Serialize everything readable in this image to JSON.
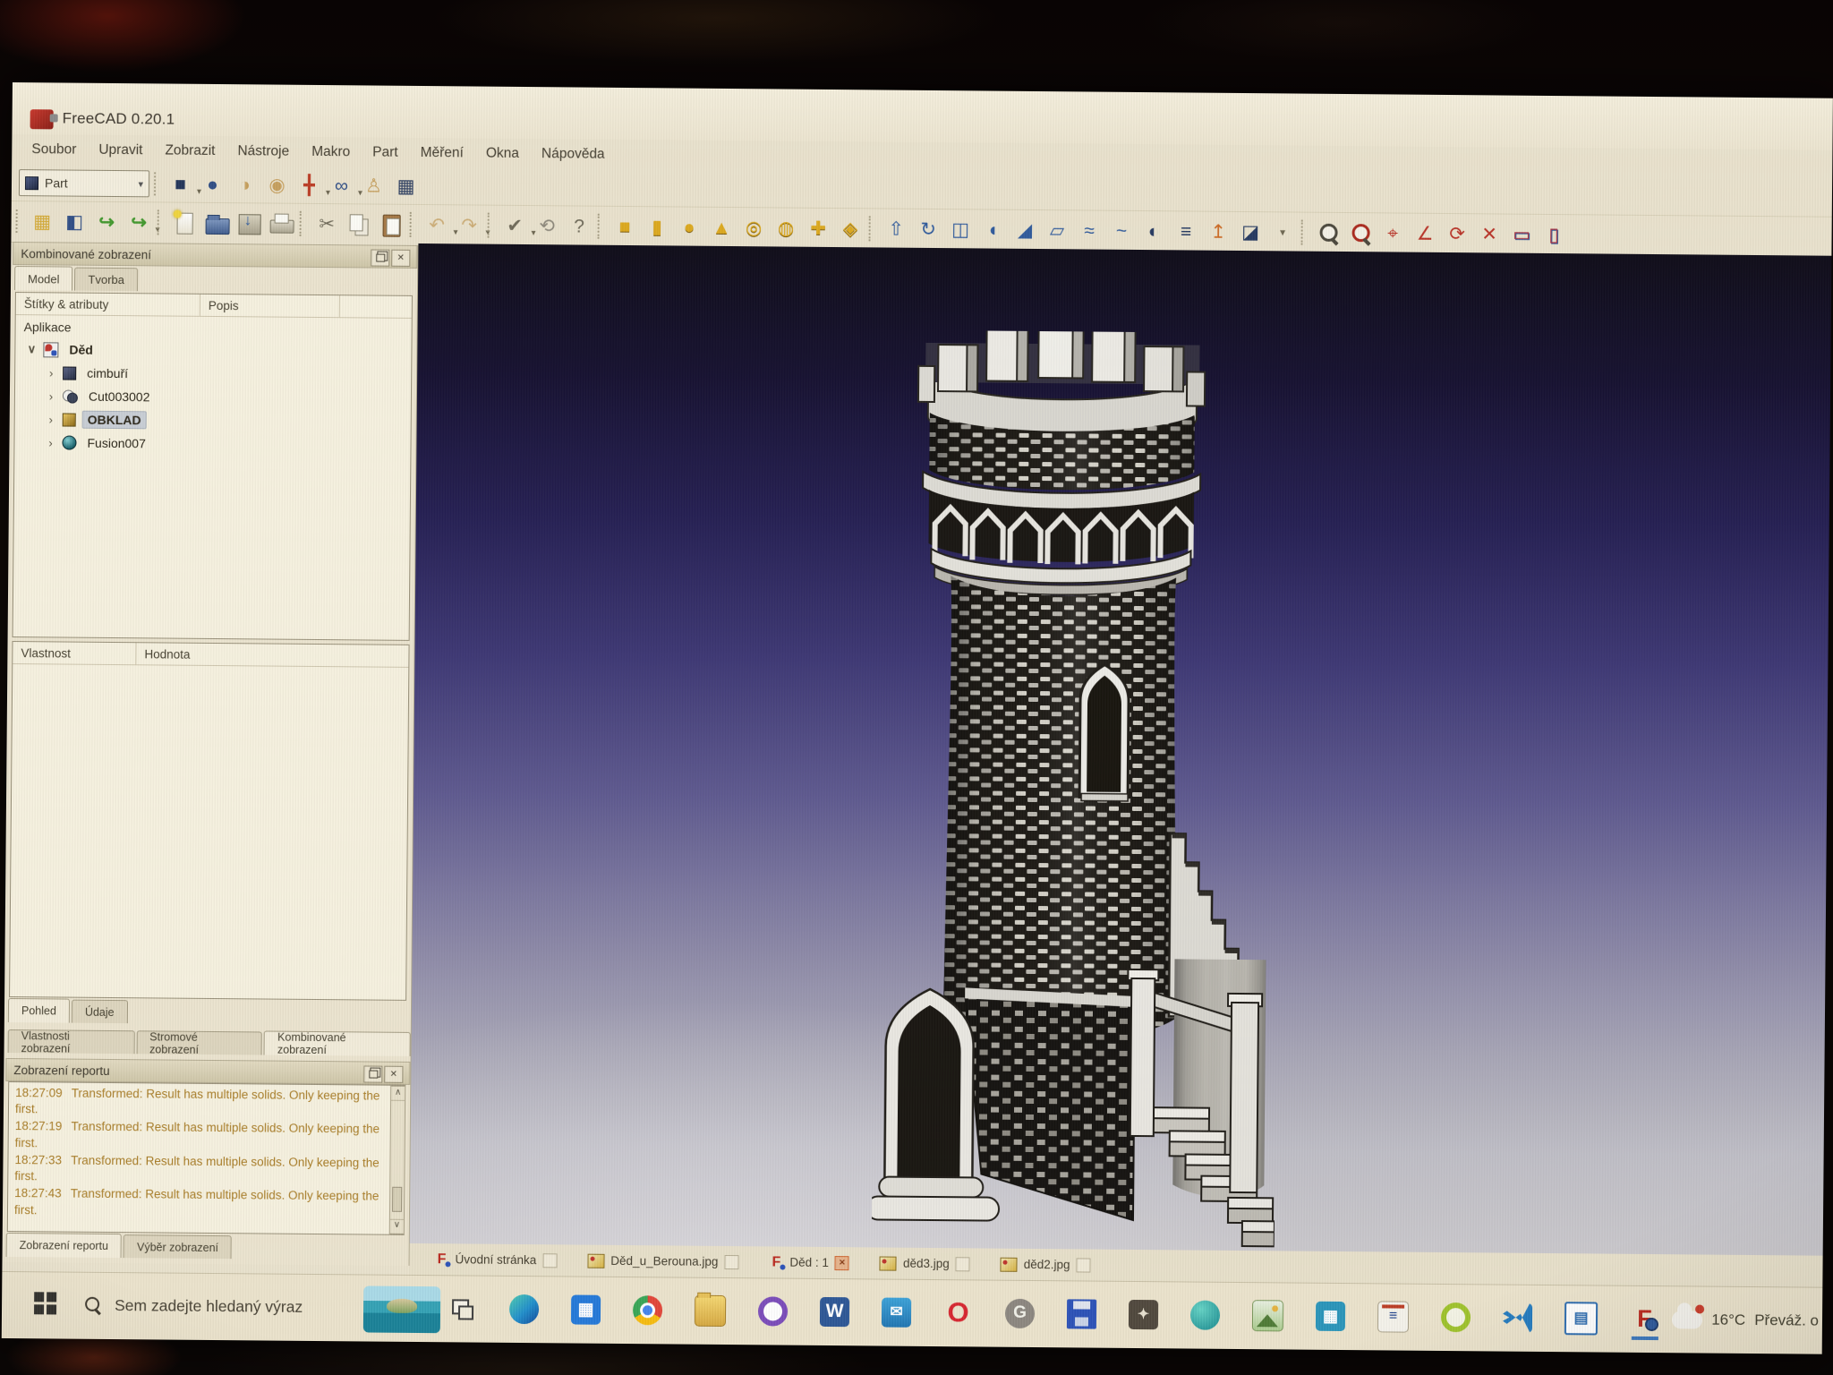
{
  "window": {
    "title": "FreeCAD 0.20.1"
  },
  "glyphs": {
    "close": "✕",
    "dropdown": "▾",
    "scroll_up": "∧",
    "scroll_down": "∨",
    "expanded": "∨",
    "collapsed": "›"
  },
  "menu": {
    "items": [
      "Soubor",
      "Upravit",
      "Zobrazit",
      "Nástroje",
      "Makro",
      "Part",
      "Měření",
      "Okna",
      "Nápověda"
    ]
  },
  "toolbar_row1": {
    "workbench_label": "Part",
    "icons": [
      {
        "name": "compound-tools-icon",
        "cls": "navy",
        "glyph": "■",
        "dd": "▾"
      },
      {
        "name": "boolean-union-icon",
        "cls": "blue",
        "glyph": "●"
      },
      {
        "name": "boolean-cut-icon",
        "cls": "tan",
        "glyph": "◑"
      },
      {
        "name": "boolean-common-icon",
        "cls": "tan",
        "glyph": "◉"
      },
      {
        "name": "pipe-tool-icon",
        "cls": "red",
        "glyph": "╋",
        "dd": "▾"
      },
      {
        "name": "join-features-icon",
        "cls": "blue",
        "glyph": "∞",
        "dd": "▾"
      },
      {
        "name": "mannequin-icon",
        "cls": "tan",
        "glyph": "♙"
      },
      {
        "name": "measure-box-icon",
        "cls": "navy",
        "glyph": "▦"
      }
    ]
  },
  "toolbar_row2": {
    "icons": [
      {
        "name": "parts-workbench-icon",
        "cls": "gold",
        "glyph": "▦"
      },
      {
        "name": "folder-blue-icon",
        "cls": "blue",
        "glyph": "◧"
      },
      {
        "name": "import-icon",
        "cls": "green",
        "glyph": "↪"
      },
      {
        "name": "export-icon",
        "cls": "green",
        "glyph": "↪",
        "dd": "▾"
      },
      {
        "cls": "sep"
      },
      {
        "name": "new-document-icon",
        "cls": "ic-new"
      },
      {
        "name": "open-document-icon",
        "cls": "ic-open"
      },
      {
        "name": "save-icon",
        "cls": "ic-save"
      },
      {
        "name": "print-icon",
        "cls": "ic-print"
      },
      {
        "cls": "sep"
      },
      {
        "name": "cut-icon",
        "cls": "dim",
        "glyph": "✂"
      },
      {
        "name": "copy-icon",
        "cls": "ic-copy"
      },
      {
        "name": "paste-icon",
        "cls": "ic-paste"
      },
      {
        "cls": "sep"
      },
      {
        "name": "undo-icon",
        "cls": "tanfade",
        "glyph": "↶",
        "dd": "▾"
      },
      {
        "name": "redo-icon",
        "cls": "tanfade",
        "glyph": "↷",
        "dd": "▾"
      },
      {
        "cls": "sep"
      },
      {
        "name": "validate-icon",
        "cls": "dim",
        "glyph": "✔",
        "dd": "▾"
      },
      {
        "name": "refresh-icon",
        "cls": "gray",
        "glyph": "⟲"
      },
      {
        "name": "whats-this-icon",
        "cls": "dim",
        "glyph": "?"
      },
      {
        "cls": "sep"
      },
      {
        "name": "box-primitive-icon",
        "cls": "goldbig",
        "glyph": "■"
      },
      {
        "name": "cylinder-primitive-icon",
        "cls": "goldbig",
        "glyph": "▮"
      },
      {
        "name": "sphere-primitive-icon",
        "cls": "goldbig",
        "glyph": "●"
      },
      {
        "name": "cone-primitive-icon",
        "cls": "goldbig",
        "glyph": "▲"
      },
      {
        "name": "torus-primitive-icon",
        "cls": "goldbig",
        "glyph": "◎"
      },
      {
        "name": "tube-primitive-icon",
        "cls": "goldbig",
        "glyph": "◍"
      },
      {
        "name": "shape-builder-icon",
        "cls": "goldbig",
        "glyph": "✚"
      },
      {
        "name": "compound-from-mesh-icon",
        "cls": "goldbig",
        "glyph": "◈"
      },
      {
        "cls": "sep"
      },
      {
        "name": "extrude-icon",
        "cls": "bluop",
        "glyph": "⇧"
      },
      {
        "name": "revolve-icon",
        "cls": "bluop",
        "glyph": "↻"
      },
      {
        "name": "mirror-icon",
        "cls": "bluop",
        "glyph": "◫"
      },
      {
        "name": "fillet-icon",
        "cls": "bluop",
        "glyph": "◖"
      },
      {
        "name": "chamfer-icon",
        "cls": "bluop",
        "glyph": "◢"
      },
      {
        "name": "ruled-surface-icon",
        "cls": "bluop",
        "glyph": "▱"
      },
      {
        "name": "loft-icon",
        "cls": "bluop",
        "glyph": "≈"
      },
      {
        "name": "sweep-icon",
        "cls": "bluop",
        "glyph": "~"
      },
      {
        "name": "section-icon",
        "cls": "navyop",
        "glyph": "◐"
      },
      {
        "name": "cross-sections-icon",
        "cls": "navyop",
        "glyph": "≡"
      },
      {
        "name": "offset-icon",
        "cls": "orangeop",
        "glyph": "↥"
      },
      {
        "name": "thickness-icon",
        "cls": "navyop",
        "glyph": "◪"
      },
      {
        "name": "more-part-tools-dropdown",
        "cls": "ddonly",
        "glyph": "▾"
      },
      {
        "cls": "sep"
      },
      {
        "name": "zoom-selection-icon",
        "cls": "ic-zoom"
      },
      {
        "name": "zoom-object-icon",
        "cls": "ic-zoom red"
      },
      {
        "name": "measure-linear-icon",
        "cls": "redop",
        "glyph": "⌖"
      },
      {
        "name": "measure-angular-icon",
        "cls": "redop",
        "glyph": "∠"
      },
      {
        "name": "measure-refresh-icon",
        "cls": "redop",
        "glyph": "⟳"
      },
      {
        "name": "measure-clear-icon",
        "cls": "redop",
        "glyph": "✕"
      },
      {
        "name": "toggle-measure-icon",
        "cls": "redblue",
        "glyph": "▭"
      },
      {
        "name": "toggle-dimensions-icon",
        "cls": "redblue",
        "glyph": "▯"
      }
    ]
  },
  "combo_view": {
    "title": "Kombinované zobrazení",
    "tabs": [
      {
        "label": "Model",
        "name": "tab-model",
        "state": "active"
      },
      {
        "label": "Tvorba",
        "name": "tab-tvorba"
      }
    ],
    "tree": {
      "columns": [
        "Štítky & atributy",
        "Popis"
      ],
      "root_label": "Aplikace",
      "document_label": "Děd",
      "children": [
        {
          "label": "cimbuří",
          "cls": "ic-cube-dark",
          "name": "tree-item-cimburi"
        },
        {
          "label": "Cut003002",
          "cls": "ic-cut",
          "name": "tree-item-cut003002"
        },
        {
          "label": "OBKLAD",
          "cls": "ic-cube-gold",
          "name": "tree-item-obklad",
          "state": "selected"
        },
        {
          "label": "Fusion007",
          "cls": "ic-fusion",
          "name": "tree-item-fusion007"
        }
      ]
    },
    "properties": {
      "columns": [
        "Vlastnost",
        "Hodnota"
      ]
    },
    "view_tabs": [
      {
        "label": "Pohled",
        "name": "tab-pohled",
        "state": "active"
      },
      {
        "label": "Údaje",
        "name": "tab-udaje"
      }
    ],
    "dock_tabs": [
      {
        "label": "Vlastnosti zobrazení",
        "name": "dock-tab-vlastnosti-zobrazeni"
      },
      {
        "label": "Stromové zobrazení",
        "name": "dock-tab-stromove-zobrazeni"
      },
      {
        "label": "Kombinované zobrazení",
        "name": "dock-tab-kombinovane-zobrazeni",
        "state": "active"
      }
    ]
  },
  "report_view": {
    "title": "Zobrazení reportu",
    "entries": [
      {
        "time": "18:27:09",
        "message": "Transformed: Result has multiple solids. Only keeping the first."
      },
      {
        "time": "18:27:19",
        "message": "Transformed: Result has multiple solids. Only keeping the first."
      },
      {
        "time": "18:27:33",
        "message": "Transformed: Result has multiple solids. Only keeping the first."
      },
      {
        "time": "18:27:43",
        "message": "Transformed: Result has multiple solids. Only keeping the first."
      }
    ],
    "bottom_tabs": [
      {
        "label": "Zobrazení reportu",
        "name": "tab-zobrazeni-reportu",
        "state": "active"
      },
      {
        "label": "Výběr zobrazení",
        "name": "tab-vyber-zobrazeni"
      }
    ]
  },
  "mdi_tabs": [
    {
      "label": "Úvodní stránka",
      "icon": "ic-fc",
      "icon_glyph": "F",
      "close": "",
      "name": "mdi-tab-uvodni-stranka"
    },
    {
      "label": "Děd_u_Berouna.jpg",
      "icon": "ic-img",
      "close": "",
      "name": "mdi-tab-ded-u-berouna"
    },
    {
      "label": "Děd : 1",
      "icon": "ic-fc",
      "icon_glyph": "F",
      "close": "orange",
      "close_glyph": "✕",
      "name": "mdi-tab-ded-1",
      "state": "active"
    },
    {
      "label": "děd3.jpg",
      "icon": "ic-img",
      "close": "",
      "name": "mdi-tab-ded3"
    },
    {
      "label": "děd2.jpg",
      "icon": "ic-img",
      "close": "",
      "name": "mdi-tab-ded2"
    }
  ],
  "taskbar": {
    "search_placeholder": "Sem zadejte hledaný výraz",
    "icons": [
      {
        "name": "task-view-icon",
        "cls": "tv"
      },
      {
        "name": "edge-icon",
        "cls": "edge"
      },
      {
        "name": "microsoft-store-icon",
        "cls": "store",
        "glyph": "▦"
      },
      {
        "name": "chrome-icon",
        "cls": "chrome"
      },
      {
        "name": "file-explorer-icon",
        "cls": "expl"
      },
      {
        "name": "privacy-app-icon",
        "cls": "purp"
      },
      {
        "name": "word-icon",
        "cls": "word",
        "glyph": "W"
      },
      {
        "name": "mail-icon",
        "cls": "mail",
        "glyph": "✉"
      },
      {
        "name": "opera-icon",
        "cls": "opera",
        "glyph": "O"
      },
      {
        "name": "gimp-icon",
        "cls": "gimp",
        "glyph": "G"
      },
      {
        "name": "floppy-tool-icon",
        "cls": "floppy"
      },
      {
        "name": "utility-app-icon",
        "cls": "darktool",
        "glyph": "✦"
      },
      {
        "name": "media-app-icon",
        "cls": "teal"
      },
      {
        "name": "photos-app-icon",
        "cls": "photos"
      },
      {
        "name": "grid-app-icon",
        "cls": "grid",
        "glyph": "▦"
      },
      {
        "name": "csn-app-icon",
        "cls": "csn",
        "glyph": "≡"
      },
      {
        "name": "lime-app-icon",
        "cls": "lime"
      },
      {
        "name": "vscode-icon",
        "cls": "vsc"
      },
      {
        "name": "libreoffice-icon",
        "cls": "lo",
        "glyph": "▤"
      },
      {
        "name": "freecad-taskbar-icon",
        "cls": "fc active-app",
        "glyph": "F"
      }
    ],
    "tray": {
      "temperature": "16°C",
      "condition": "Převáž. o"
    }
  },
  "viewport": {
    "content": "castle tower 3D model",
    "background_top": "#0a0714",
    "background_mid": "#393374",
    "background_bottom": "#c9c7cb",
    "model_light": "#e9e7e1",
    "model_dark": "#181510",
    "selection_color": "#c9ced6",
    "report_text_color": "#ab7d22"
  }
}
